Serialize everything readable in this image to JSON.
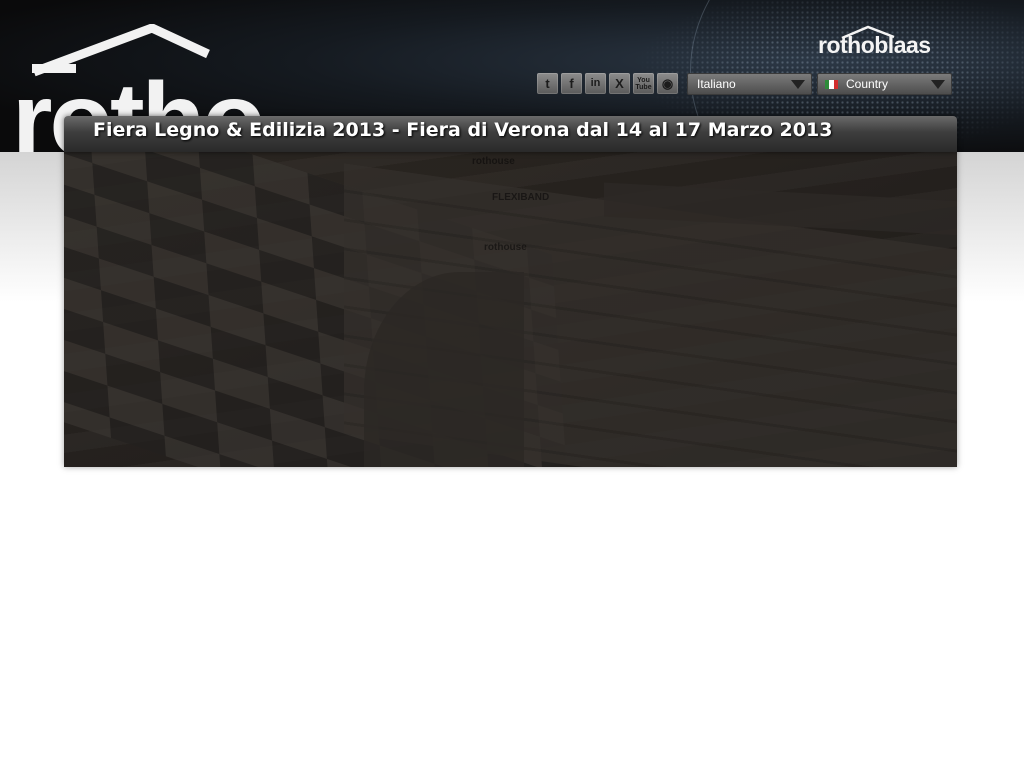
{
  "header": {
    "big_logo_text": "rotho",
    "brand_name": "rothoblaas"
  },
  "socials": [
    {
      "name": "twitter-icon",
      "glyph": "t"
    },
    {
      "name": "facebook-icon",
      "glyph": "f"
    },
    {
      "name": "linkedin-icon",
      "glyph": "in"
    },
    {
      "name": "xing-icon",
      "glyph": "X"
    },
    {
      "name": "youtube-icon",
      "glyph": "You\nTube"
    },
    {
      "name": "rss-icon",
      "glyph": "◉"
    }
  ],
  "language_select": {
    "selected": "Italiano"
  },
  "country_select": {
    "selected": "Country",
    "flag_colors": [
      "#2e8b3a",
      "#ffffff",
      "#d22e2e"
    ]
  },
  "banner": {
    "title": "Fiera Legno & Edilizia 2013 - Fiera di Verona dal 14 al 17 Marzo 2013",
    "labels": [
      "rothouse",
      "FLEXIBAND",
      "rothouse"
    ]
  },
  "colors": {
    "header_dark": "#0a0a0b",
    "title_bar": "#3d3d3d",
    "hero_overlay": "#2c2823"
  }
}
